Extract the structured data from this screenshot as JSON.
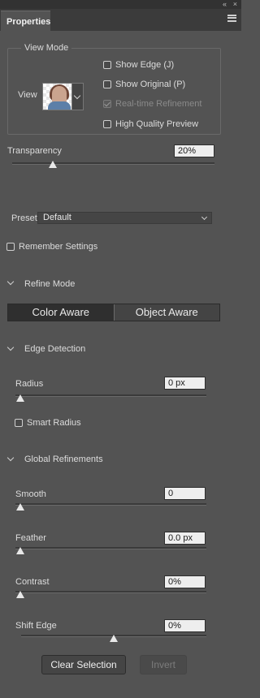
{
  "topbar": {
    "collapse_glyph": "«",
    "menu_glyph": "×"
  },
  "tab": {
    "title": "Properties"
  },
  "view_mode": {
    "legend": "View Mode",
    "view_label": "View",
    "options": {
      "show_edge": "Show Edge (J)",
      "show_original": "Show Original (P)",
      "realtime": "Real-time Refinement",
      "hq_preview": "High Quality Preview"
    }
  },
  "transparency": {
    "label": "Transparency",
    "value": "20%",
    "level": 0.2
  },
  "preset": {
    "label": "Preset",
    "value": "Default"
  },
  "remember": {
    "label": "Remember Settings"
  },
  "refine_mode": {
    "title": "Refine Mode",
    "color_aware": "Color Aware",
    "object_aware": "Object Aware"
  },
  "edge_detection": {
    "title": "Edge Detection",
    "radius_label": "Radius",
    "radius_value": "0 px",
    "smart_radius": "Smart Radius"
  },
  "global": {
    "title": "Global Refinements",
    "smooth_label": "Smooth",
    "smooth_value": "0",
    "feather_label": "Feather",
    "feather_value": "0.0 px",
    "contrast_label": "Contrast",
    "contrast_value": "0%",
    "shift_label": "Shift Edge",
    "shift_value": "0%",
    "shift_level": 0.5
  },
  "buttons": {
    "clear": "Clear Selection",
    "invert": "Invert"
  },
  "icons": [
    "collapse-icon",
    "panel-menu-icon",
    "chevron-down-icon",
    "disclosure-icon",
    "slider-thumb-icon"
  ]
}
